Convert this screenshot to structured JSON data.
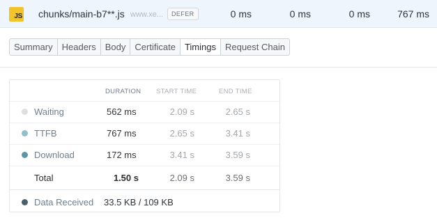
{
  "request": {
    "type_icon": "js-file-icon",
    "type_label": "JS",
    "file_name": "chunks/main-b7**.js",
    "host": "www.xe...",
    "badge": "DEFER",
    "metrics": [
      "0 ms",
      "0 ms",
      "0 ms",
      "767 ms"
    ]
  },
  "tabs": [
    {
      "label": "Summary",
      "active": false
    },
    {
      "label": "Headers",
      "active": false
    },
    {
      "label": "Body",
      "active": false
    },
    {
      "label": "Certificate",
      "active": false
    },
    {
      "label": "Timings",
      "active": true
    },
    {
      "label": "Request Chain",
      "active": false
    }
  ],
  "timings": {
    "columns": {
      "duration": "DURATION",
      "start": "START TIME",
      "end": "END TIME"
    },
    "rows": [
      {
        "label": "Waiting",
        "duration": "562 ms",
        "start": "2.09 s",
        "end": "2.65 s",
        "color": "#dedfe0"
      },
      {
        "label": "TTFB",
        "duration": "767 ms",
        "start": "2.65 s",
        "end": "3.41 s",
        "color": "#8fc1cd"
      },
      {
        "label": "Download",
        "duration": "172 ms",
        "start": "3.41 s",
        "end": "3.59 s",
        "color": "#5f95ab"
      }
    ],
    "total": {
      "label": "Total",
      "duration": "1.50 s",
      "start": "2.09 s",
      "end": "3.59 s"
    },
    "data_received": {
      "label": "Data Received",
      "value": "33.5 KB / 109 KB",
      "color": "#47606d"
    }
  }
}
